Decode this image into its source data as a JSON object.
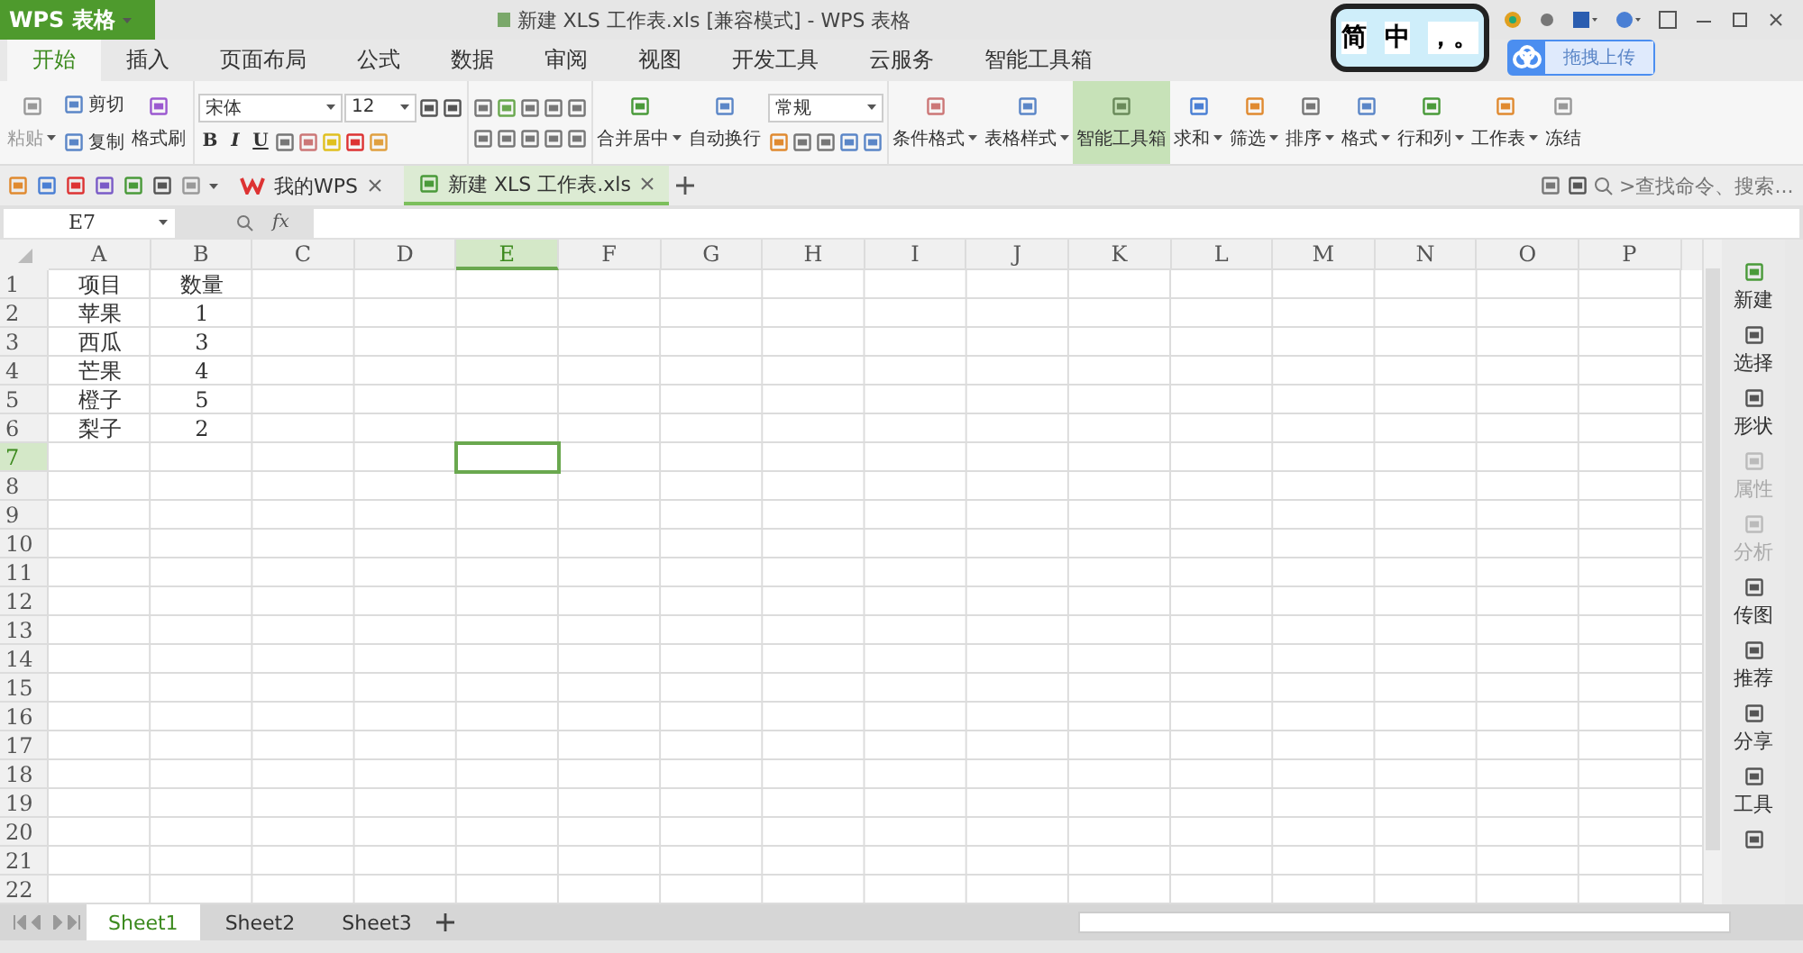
{
  "app_menu": {
    "label": "WPS 表格"
  },
  "window": {
    "title": "新建 XLS 工作表.xls [兼容模式] - WPS 表格"
  },
  "ime": {
    "mode": "简",
    "lang": "中",
    "punct": "，。"
  },
  "cloud_upload": {
    "label": "拖拽上传"
  },
  "ribbon_tabs": [
    {
      "label": "开始",
      "selected": true
    },
    {
      "label": "插入",
      "selected": false
    },
    {
      "label": "页面布局",
      "selected": false
    },
    {
      "label": "公式",
      "selected": false
    },
    {
      "label": "数据",
      "selected": false
    },
    {
      "label": "审阅",
      "selected": false
    },
    {
      "label": "视图",
      "selected": false
    },
    {
      "label": "开发工具",
      "selected": false
    },
    {
      "label": "云服务",
      "selected": false
    },
    {
      "label": "智能工具箱",
      "selected": false
    }
  ],
  "clipboard": {
    "paste": "粘贴",
    "cut": "剪切",
    "copy": "复制",
    "format_painter": "格式刷"
  },
  "font": {
    "family": "宋体",
    "size": "12",
    "bold": "B",
    "italic": "I",
    "underline": "U"
  },
  "number_format": {
    "value": "常规"
  },
  "large_buttons": [
    {
      "label": "合并居中",
      "dropdown": true,
      "highlighted": false
    },
    {
      "label": "自动换行",
      "dropdown": false,
      "highlighted": false
    },
    {
      "label": "条件格式",
      "dropdown": true,
      "highlighted": false
    },
    {
      "label": "表格样式",
      "dropdown": true,
      "highlighted": false
    },
    {
      "label": "智能工具箱",
      "dropdown": false,
      "highlighted": true
    },
    {
      "label": "求和",
      "dropdown": true,
      "highlighted": false
    },
    {
      "label": "筛选",
      "dropdown": true,
      "highlighted": false
    },
    {
      "label": "排序",
      "dropdown": true,
      "highlighted": false
    },
    {
      "label": "格式",
      "dropdown": true,
      "highlighted": false
    },
    {
      "label": "行和列",
      "dropdown": true,
      "highlighted": false
    },
    {
      "label": "工作表",
      "dropdown": true,
      "highlighted": false
    },
    {
      "label": "冻结",
      "dropdown": false,
      "highlighted": false
    }
  ],
  "doc_tabs": [
    {
      "label": "我的WPS",
      "selected": false
    },
    {
      "label": "新建 XLS 工作表.xls",
      "selected": true
    }
  ],
  "search": {
    "placeholder": ">查找命令、搜索..."
  },
  "formula_bar": {
    "cell_ref": "E7",
    "fx": "fx"
  },
  "sheet": {
    "columns": [
      {
        "label": "A",
        "selected": false
      },
      {
        "label": "B",
        "selected": false
      },
      {
        "label": "C",
        "selected": false
      },
      {
        "label": "D",
        "selected": false
      },
      {
        "label": "E",
        "selected": true
      },
      {
        "label": "F",
        "selected": false
      },
      {
        "label": "G",
        "selected": false
      },
      {
        "label": "H",
        "selected": false
      },
      {
        "label": "I",
        "selected": false
      },
      {
        "label": "J",
        "selected": false
      },
      {
        "label": "K",
        "selected": false
      },
      {
        "label": "L",
        "selected": false
      },
      {
        "label": "M",
        "selected": false
      },
      {
        "label": "N",
        "selected": false
      },
      {
        "label": "O",
        "selected": false
      },
      {
        "label": "P",
        "selected": false
      }
    ],
    "rows": [
      {
        "label": "1",
        "selected": false,
        "cells": [
          "项目",
          "数量"
        ]
      },
      {
        "label": "2",
        "selected": false,
        "cells": [
          "苹果",
          "1"
        ]
      },
      {
        "label": "3",
        "selected": false,
        "cells": [
          "西瓜",
          "3"
        ]
      },
      {
        "label": "4",
        "selected": false,
        "cells": [
          "芒果",
          "4"
        ]
      },
      {
        "label": "5",
        "selected": false,
        "cells": [
          "橙子",
          "5"
        ]
      },
      {
        "label": "6",
        "selected": false,
        "cells": [
          "梨子",
          "2"
        ]
      },
      {
        "label": "7",
        "selected": true,
        "cells": []
      },
      {
        "label": "8",
        "selected": false,
        "cells": []
      },
      {
        "label": "9",
        "selected": false,
        "cells": []
      },
      {
        "label": "10",
        "selected": false,
        "cells": []
      },
      {
        "label": "11",
        "selected": false,
        "cells": []
      },
      {
        "label": "12",
        "selected": false,
        "cells": []
      },
      {
        "label": "13",
        "selected": false,
        "cells": []
      },
      {
        "label": "14",
        "selected": false,
        "cells": []
      },
      {
        "label": "15",
        "selected": false,
        "cells": []
      },
      {
        "label": "16",
        "selected": false,
        "cells": []
      },
      {
        "label": "17",
        "selected": false,
        "cells": []
      },
      {
        "label": "18",
        "selected": false,
        "cells": []
      },
      {
        "label": "19",
        "selected": false,
        "cells": []
      },
      {
        "label": "20",
        "selected": false,
        "cells": []
      },
      {
        "label": "21",
        "selected": false,
        "cells": []
      },
      {
        "label": "22",
        "selected": false,
        "cells": []
      }
    ]
  },
  "side_panel": [
    {
      "label": "新建",
      "disabled": false
    },
    {
      "label": "选择",
      "disabled": false
    },
    {
      "label": "形状",
      "disabled": false
    },
    {
      "label": "属性",
      "disabled": true
    },
    {
      "label": "分析",
      "disabled": true
    },
    {
      "label": "传图",
      "disabled": false
    },
    {
      "label": "推荐",
      "disabled": false
    },
    {
      "label": "分享",
      "disabled": false
    },
    {
      "label": "工具",
      "disabled": false
    }
  ],
  "sheet_tabs": [
    {
      "label": "Sheet1",
      "selected": true
    },
    {
      "label": "Sheet2",
      "selected": false
    },
    {
      "label": "Sheet3",
      "selected": false
    }
  ]
}
